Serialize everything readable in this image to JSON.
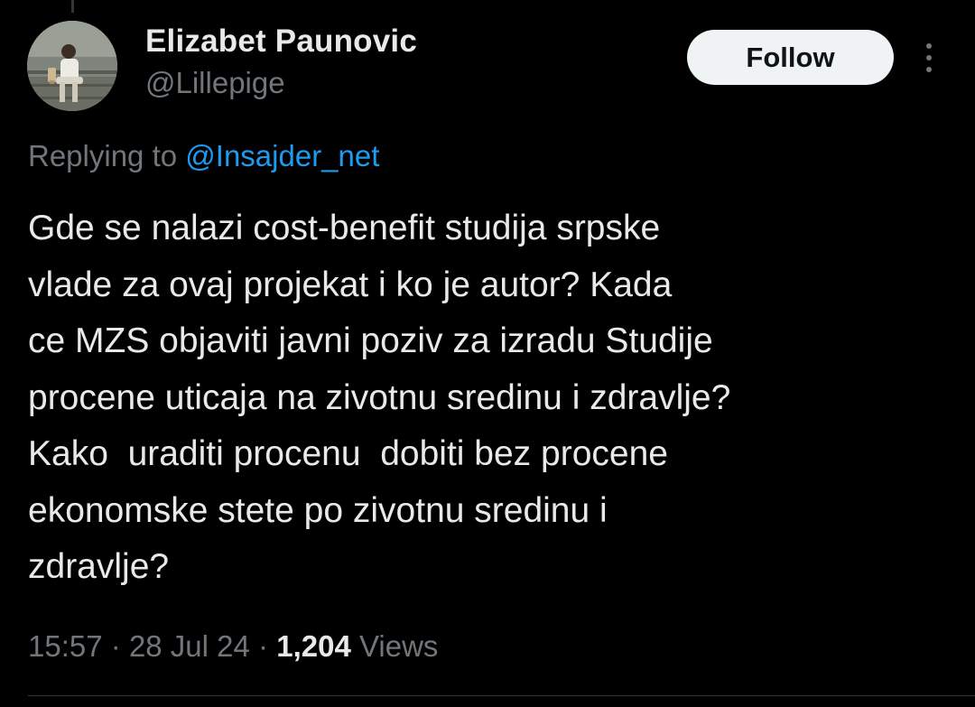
{
  "author": {
    "display_name": "Elizabet Paunovic",
    "handle": "@Lillepige"
  },
  "follow_label": "Follow",
  "reply": {
    "prefix": "Replying to",
    "mention": "@Insajder_net"
  },
  "tweet": {
    "text": "Gde se nalazi cost-benefit studija srpske\nvlade za ovaj projekat i ko je autor? Kada\nce MZS objaviti javni poziv za izradu Studije\nprocene uticaja na zivotnu sredinu i zdravlje?\nKako  uraditi procenu  dobiti bez procene\nekonomske stete po zivotnu sredinu i\nzdravlje?"
  },
  "meta": {
    "time": "15:57",
    "date": "28 Jul 24",
    "separator": "·",
    "views_count": "1,204",
    "views_label": "Views"
  },
  "colors": {
    "background": "#000000",
    "text": "#e7e9ea",
    "secondary": "#71767b",
    "link": "#1d9bf0",
    "button": "#eff3f4"
  },
  "icons": {
    "more": "more-vertical-icon"
  }
}
